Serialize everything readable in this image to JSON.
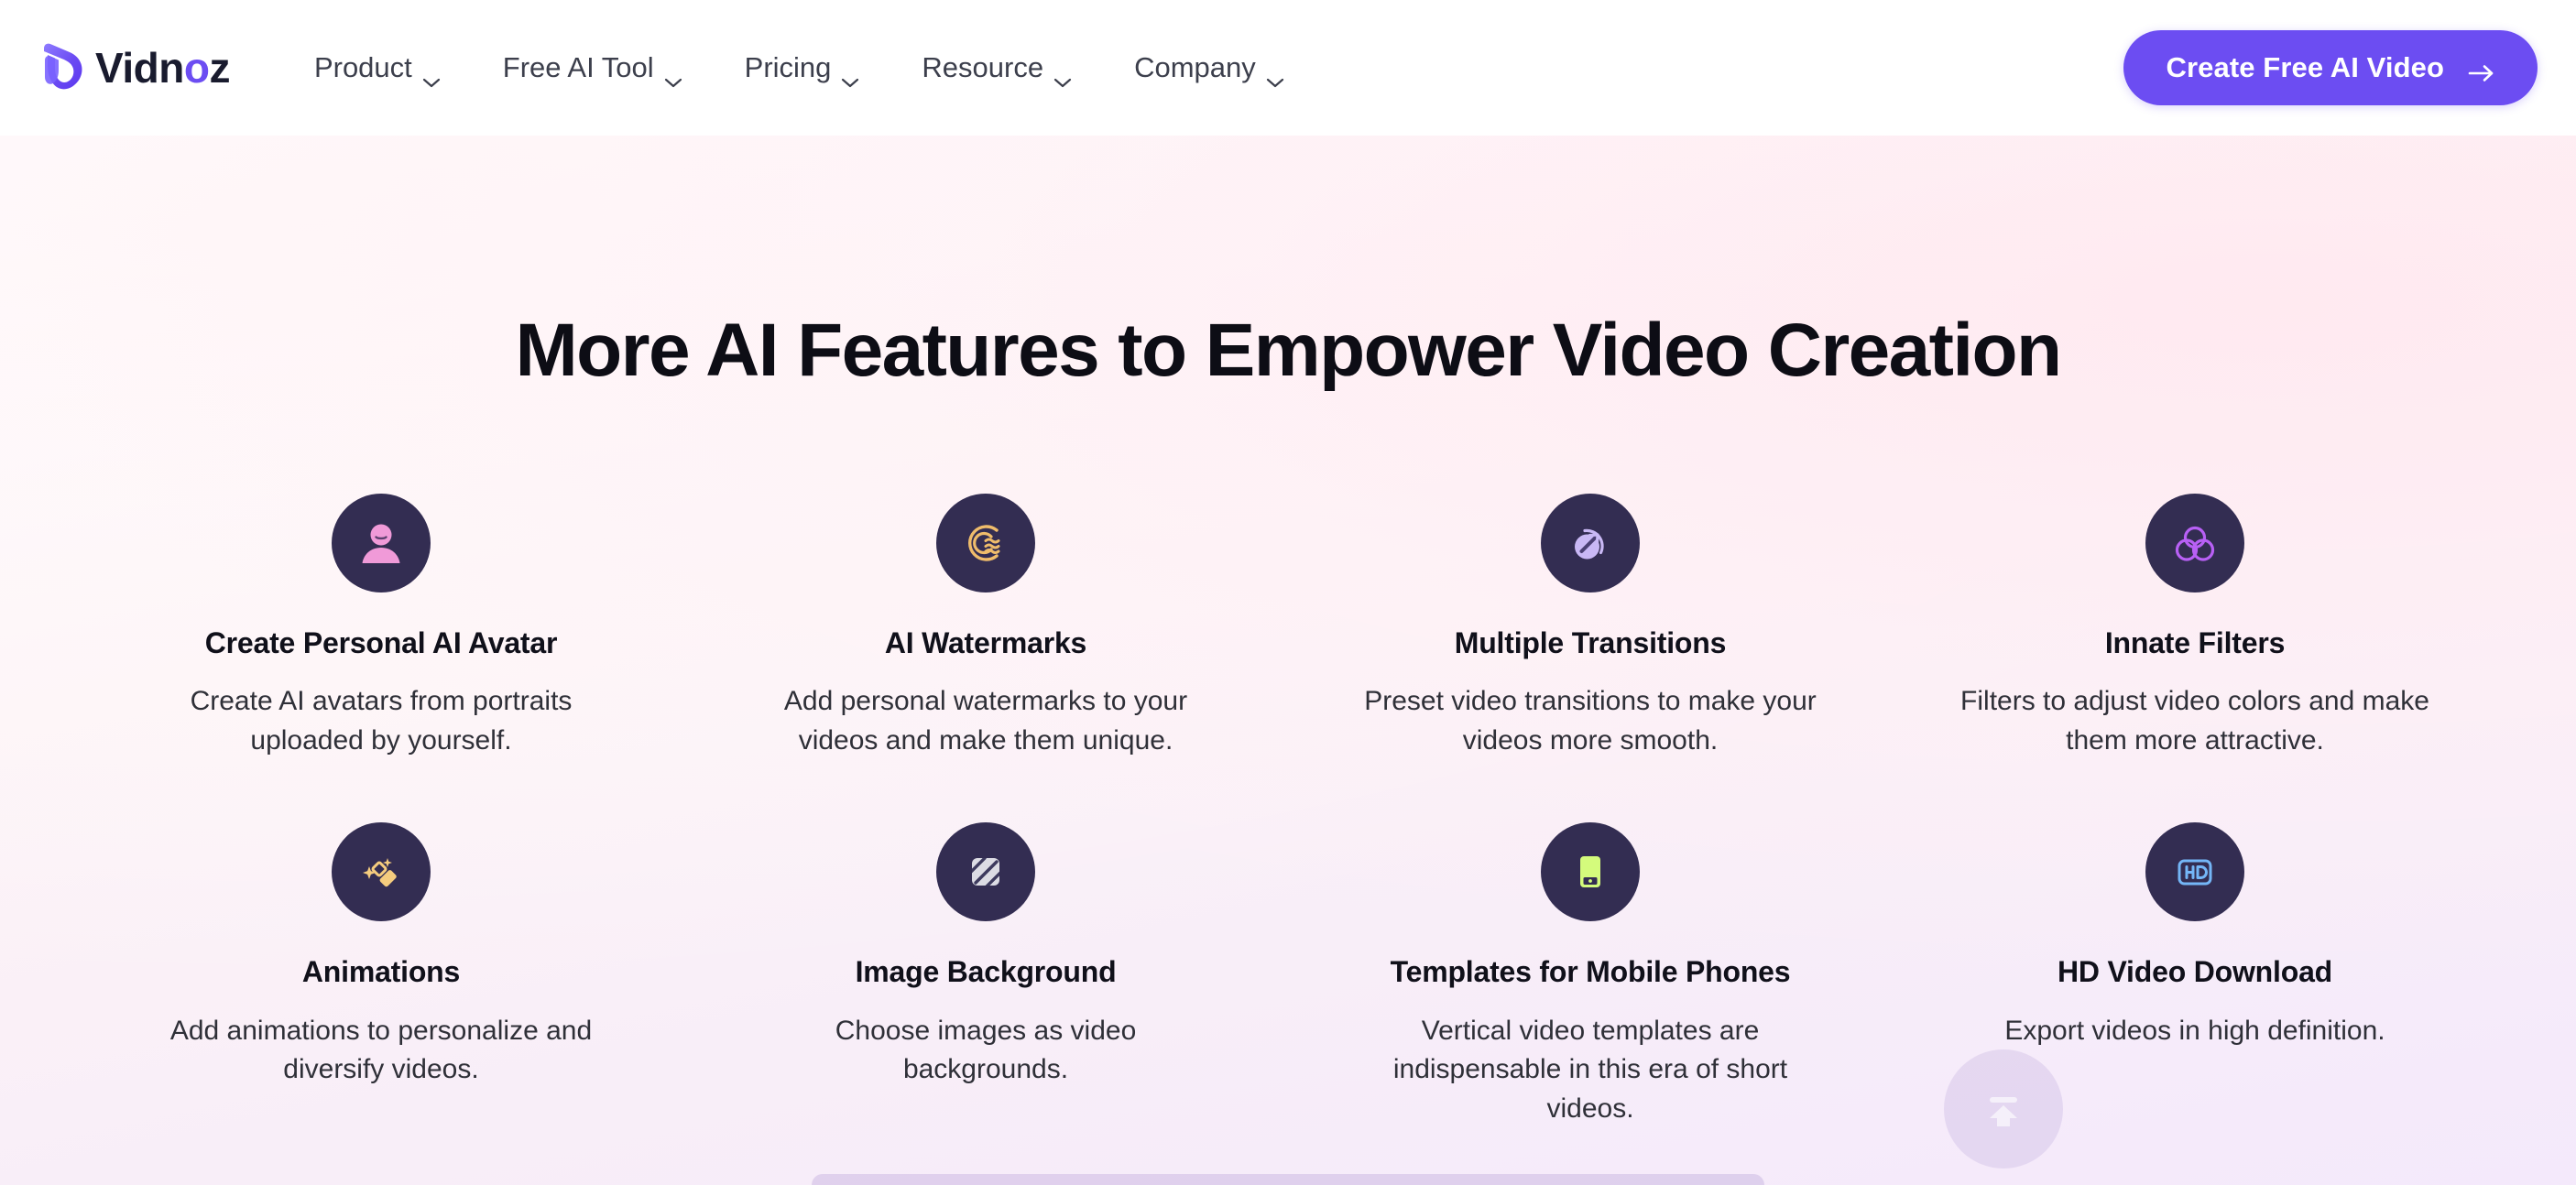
{
  "header": {
    "brand": {
      "name_part1": "Vidn",
      "name_accent": "o",
      "name_part2": "z",
      "logo_icon": "vidnoz-v-logo-icon"
    },
    "nav": [
      {
        "label": "Product",
        "icon": "chevron-down-icon"
      },
      {
        "label": "Free AI Tool",
        "icon": "chevron-down-icon"
      },
      {
        "label": "Pricing",
        "icon": "chevron-down-icon"
      },
      {
        "label": "Resource",
        "icon": "chevron-down-icon"
      },
      {
        "label": "Company",
        "icon": "chevron-down-icon"
      }
    ],
    "cta": {
      "label": "Create Free AI Video",
      "icon": "arrow-right-icon",
      "color": "#6c4df2"
    }
  },
  "section": {
    "title": "More AI Features to Empower Video Creation",
    "features": [
      {
        "title": "Create Personal AI Avatar",
        "desc": "Create AI avatars from portraits uploaded by yourself.",
        "icon": "person-avatar-icon",
        "icon_color": "#f09ad8",
        "badge_color": "#332d52"
      },
      {
        "title": "AI Watermarks",
        "desc": "Add personal watermarks to your videos and make them unique.",
        "icon": "watermark-waves-icon",
        "icon_color": "#efbc6b",
        "badge_color": "#332d52"
      },
      {
        "title": "Multiple Transitions",
        "desc": "Preset video transitions to make your videos more smooth.",
        "icon": "transition-arrow-icon",
        "icon_color": "#c9b8f5",
        "badge_color": "#332d52"
      },
      {
        "title": "Innate Filters",
        "desc": "Filters to adjust video colors and make them more attractive.",
        "icon": "three-circles-filter-icon",
        "icon_color": "#b860f5",
        "badge_color": "#332d52"
      },
      {
        "title": "Animations",
        "desc": "Add animations to personalize and diversify videos.",
        "icon": "magic-wand-sparkle-icon",
        "icon_color": "#f5cc7e",
        "badge_color": "#332d52"
      },
      {
        "title": "Image Background",
        "desc": "Choose images as video backgrounds.",
        "icon": "striped-square-image-icon",
        "icon_color": "#dcdce4",
        "badge_color": "#332d52"
      },
      {
        "title": "Templates for Mobile Phones",
        "desc": "Vertical video templates are indispensable in this era of short videos.",
        "icon": "mobile-phone-icon",
        "icon_color": "#d4fb7c",
        "badge_color": "#332d52"
      },
      {
        "title": "HD Video Download",
        "desc": "Export videos in high definition.",
        "icon": "hd-badge-icon",
        "icon_color": "#74b6f7",
        "badge_color": "#332d52"
      }
    ]
  },
  "scroll_top": {
    "label": "Back to top",
    "icon": "arrow-up-to-line-icon"
  }
}
